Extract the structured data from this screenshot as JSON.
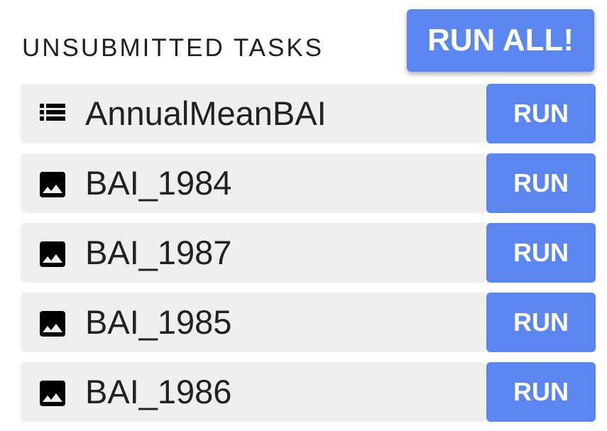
{
  "header": {
    "title": "UNSUBMITTED TASKS",
    "run_all_label": "RUN ALL!"
  },
  "colors": {
    "accent": "#5b86f0",
    "row_background": "#efefef",
    "text": "#202124"
  },
  "tasks": [
    {
      "icon": "table-icon",
      "name": "AnnualMeanBAI",
      "run_label": "RUN"
    },
    {
      "icon": "image-icon",
      "name": "BAI_1984",
      "run_label": "RUN"
    },
    {
      "icon": "image-icon",
      "name": "BAI_1987",
      "run_label": "RUN"
    },
    {
      "icon": "image-icon",
      "name": "BAI_1985",
      "run_label": "RUN"
    },
    {
      "icon": "image-icon",
      "name": "BAI_1986",
      "run_label": "RUN"
    }
  ]
}
